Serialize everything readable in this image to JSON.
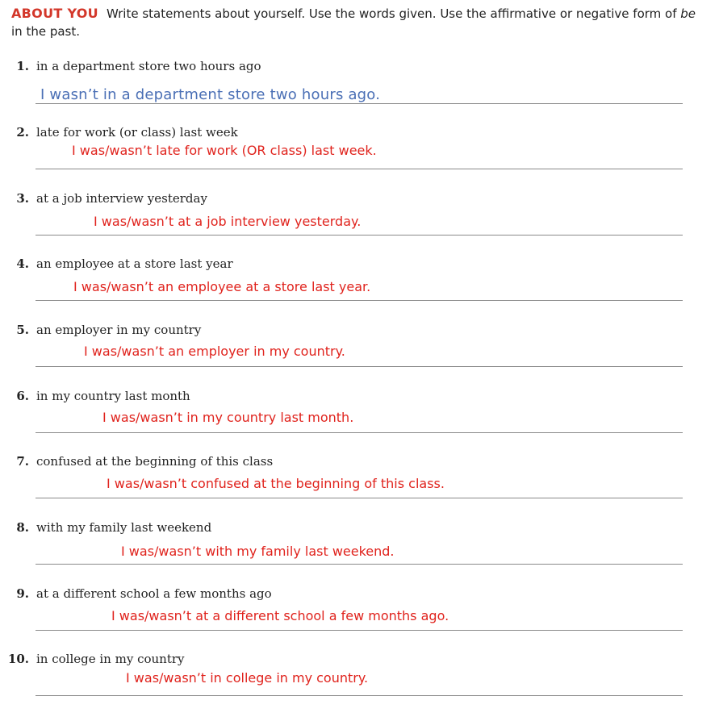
{
  "header": {
    "label": "ABOUT YOU",
    "instructions_part1": "Write statements about yourself. Use the words given. Use the affirmative or negative form of ",
    "instructions_be": "be",
    "instructions_part2": " in the past."
  },
  "items": [
    {
      "number": "1.",
      "prompt": "in a department store two hours ago",
      "answer": "I wasn’t in a department store two hours ago."
    },
    {
      "number": "2.",
      "prompt": "late for work (or class) last week",
      "answer": "I was/wasn’t late for work (OR class) last week."
    },
    {
      "number": "3.",
      "prompt": "at a job interview yesterday",
      "answer": "I was/wasn’t at a job interview yesterday."
    },
    {
      "number": "4.",
      "prompt": "an employee at a store last year",
      "answer": "I was/wasn’t an employee at a store last year."
    },
    {
      "number": "5.",
      "prompt": "an employer in my country",
      "answer": "I was/wasn’t an employer in my country."
    },
    {
      "number": "6.",
      "prompt": "in my country last month",
      "answer": "I was/wasn’t in my country last month."
    },
    {
      "number": "7.",
      "prompt": "confused at the beginning of this class",
      "answer": "I was/wasn’t confused at the beginning of this class."
    },
    {
      "number": "8.",
      "prompt": "with my family last weekend",
      "answer": "I was/wasn’t with my family last weekend."
    },
    {
      "number": "9.",
      "prompt": "at a different school a few months ago",
      "answer": "I was/wasn’t at a different school a few months ago."
    },
    {
      "number": "10.",
      "prompt": "in college in my country",
      "answer": "I was/wasn’t in college in my country."
    }
  ]
}
